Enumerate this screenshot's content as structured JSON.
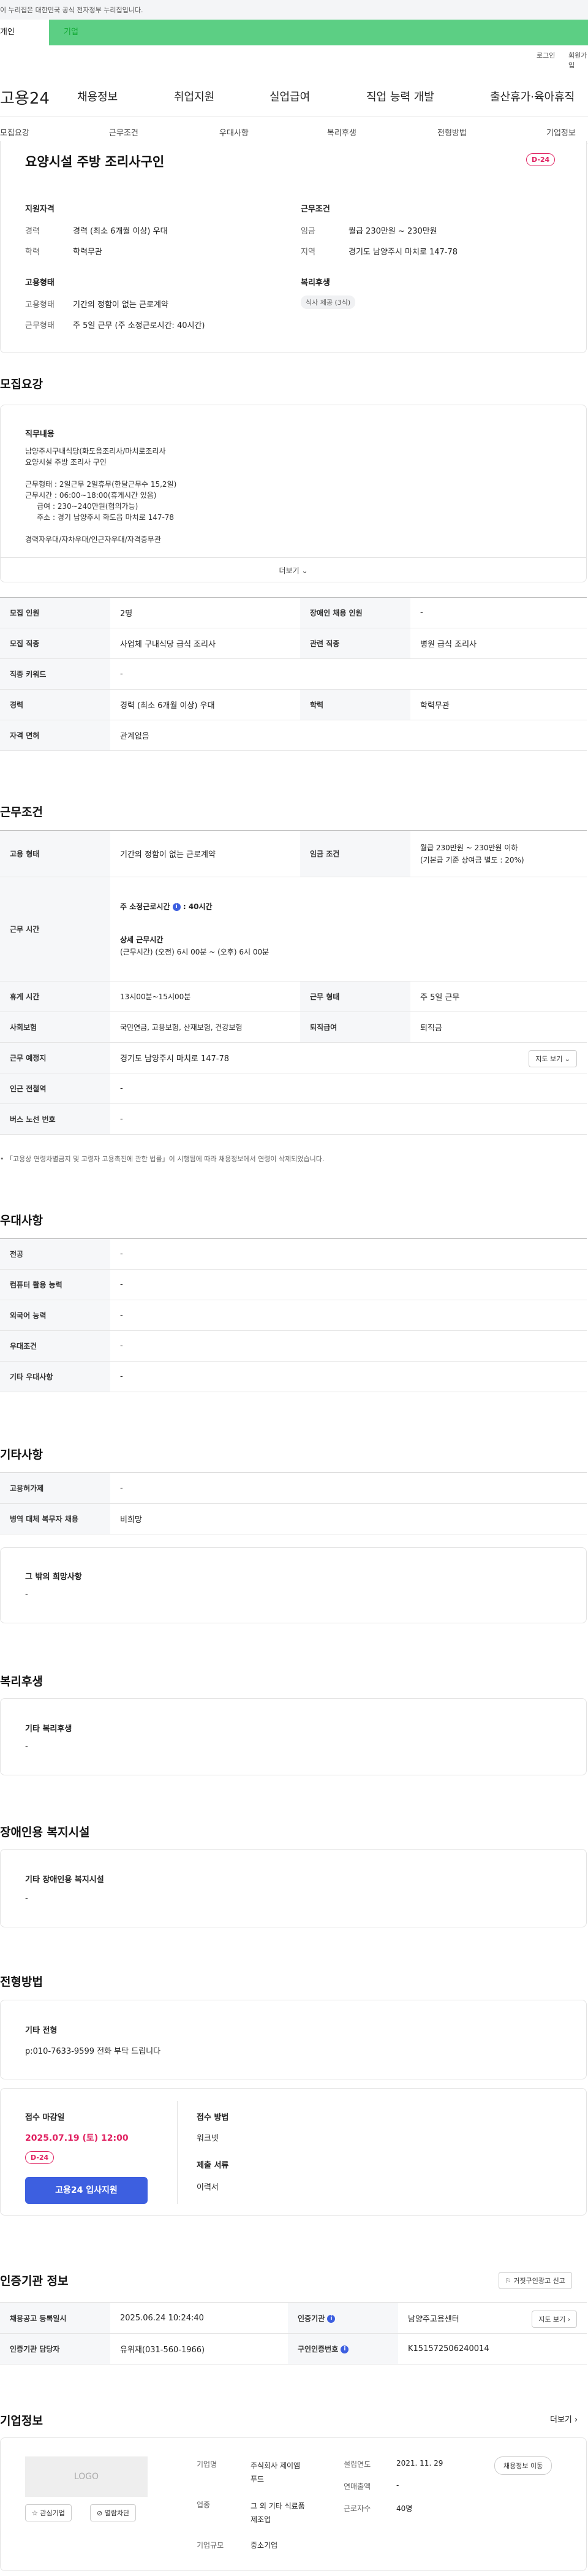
{
  "topbar": {
    "notice": "이 누리집은 대한민국 공식 전자정부 누리집입니다."
  },
  "greenbar": {
    "tab1": "개인",
    "tab2": "기업"
  },
  "util": {
    "login": "로그인",
    "join": "회원가입"
  },
  "gnb": {
    "logo": "고용24",
    "menu": [
      "채용정보",
      "취업지원",
      "실업급여",
      "직업 능력 개발",
      "출산휴가·육아휴직"
    ]
  },
  "subtabs": [
    "모집요강",
    "근무조건",
    "우대사항",
    "복리후생",
    "전형방법",
    "기업정보"
  ],
  "summary": {
    "title": "요양시설 주방 조리사구인",
    "dday": "D-24",
    "qual_title": "지원자격",
    "career_label": "경력",
    "career_val": "경력 (최소 6개월 이상) 우대",
    "edu_label": "학력",
    "edu_val": "학력무관",
    "cond_title": "근무조건",
    "wage_label": "임금",
    "wage_val": "월급 230만원 ~ 230만원",
    "area_label": "지역",
    "area_val": "경기도 남양주시 마치로 147-78",
    "emp_title": "고용형태",
    "emp_label": "고용형태",
    "emp_val": "기간의 정함이 없는 근로계약",
    "hours_label": "근무형태",
    "hours_val": "주 5일 근무 (주 소정근로시간: 40시간)",
    "welfare_title": "복리후생",
    "welfare_chip": "식사 제공 (3식)"
  },
  "recruit": {
    "title": "모집요강",
    "duty_title": "직무내용",
    "duty_lines": [
      "남양주시구내식당(화도읍조리사/마치로조리사",
      "요양시설 주방 조리사 구인",
      "",
      "근무형태 : 2일근무 2일휴무(한달근무수 15,2일)",
      "근무시간 : 06:00~18:00(휴게시간 있음)",
      "     급여 : 230~240만원(협의가능)",
      "     주소 : 경기 남양주시 화도읍 마치로 147-78",
      "",
      "경력자우대/자차우대/인근자우대/자격증무관"
    ],
    "more": "더보기",
    "rows": [
      {
        "h1": "모집 인원",
        "v1": "2명",
        "h2": "장애인 채용 인원",
        "v2": "-"
      },
      {
        "h1": "모집 직종",
        "v1": "사업체 구내식당 급식 조리사",
        "h2": "관련 직종",
        "v2": "병원 급식 조리사"
      },
      {
        "h1": "직종 키워드",
        "v1": "-"
      },
      {
        "h1": "경력",
        "v1": "경력 (최소 6개월 이상) 우대",
        "h2": "학력",
        "v2": "학력무관"
      },
      {
        "h1": "자격 면허",
        "v1": "관계없음"
      }
    ]
  },
  "work": {
    "title": "근무조건",
    "emp_h": "고용 형태",
    "emp_v": "기간의 정함이 없는 근로계약",
    "wage_h": "임금 조건",
    "wage_v1": "월급 230만원 ~ 230만원 이하",
    "wage_v2": "(기본급 기준 상여금 별도 : 20%)",
    "time_h": "근무 시간",
    "time_v1": "주 소정근로시간",
    "time_v1b": ": 40시간",
    "time_v2": "상세 근무시간",
    "time_v3": "(근무시간) (오전) 6시 00분 ~ (오후) 6시 00분",
    "rest_h": "휴게 시간",
    "rest_v": "13시00분~15시00분",
    "form_h": "근무 형태",
    "form_v": "주 5일 근무",
    "ins_h": "사회보험",
    "ins_v": "국민연금, 고용보험, 산재보험, 건강보험",
    "sev_h": "퇴직급여",
    "sev_v": "퇴직금",
    "place_h": "근무 예정지",
    "place_v": "경기도 남양주시 마치로 147-78",
    "map_btn": "지도 보기",
    "sub_h": "인근 전철역",
    "sub_v": "-",
    "bus_h": "버스 노선 번호",
    "bus_v": "-",
    "note": "「고용상 연령차별금지 및 고령자 고용촉진에 관한 법률」이 시행됨에 따라 채용정보에서 연령이 삭제되었습니다."
  },
  "pref": {
    "title": "우대사항",
    "rows": [
      {
        "h": "전공",
        "v": "-"
      },
      {
        "h": "컴퓨터 활용 능력",
        "v": "-"
      },
      {
        "h": "외국어 능력",
        "v": "-"
      },
      {
        "h": "우대조건",
        "v": "-"
      },
      {
        "h": "기타 우대사항",
        "v": "-"
      }
    ]
  },
  "etc": {
    "title": "기타사항",
    "rows": [
      {
        "h": "고용허가제",
        "v": "-"
      },
      {
        "h": "병역 대체 복무자 채용",
        "v": "비희망"
      }
    ],
    "box_title": "그 밖의 희망사항",
    "box_val": "-"
  },
  "welfare": {
    "title": "복리후생",
    "box_title": "기타 복리후생",
    "box_val": "-"
  },
  "disab": {
    "title": "장애인용 복지시설",
    "box_title": "기타 장애인용 복지시설",
    "box_val": "-"
  },
  "process": {
    "title": "전형방법",
    "box_title": "기타 전형",
    "box_val": "p:010-7633-9599 전화 부탁 드립니다",
    "deadline_label": "접수 마감일",
    "deadline_val": "2025.07.19 (토) 12:00",
    "dday": "D-24",
    "apply_btn": "고용24 입사지원",
    "method_label": "접수 방법",
    "method_val": "워크넷",
    "docs_label": "제출 서류",
    "docs_val": "이력서"
  },
  "cert": {
    "title": "인증기관 정보",
    "report_btn": "거짓구인광고 신고",
    "reg_h": "채용공고 등록일시",
    "reg_v": "2025.06.24 10:24:40",
    "org_h": "인증기관",
    "org_v": "남양주고용센터",
    "map_btn": "지도 보기",
    "mgr_h": "인증기관 담당자",
    "mgr_v": "유위재(031-560-1966)",
    "no_h": "구인인증번호",
    "no_v": "K151572506240014"
  },
  "company": {
    "title": "기업정보",
    "more": "더보기",
    "logo": "LOGO",
    "fav_btn": "관심기업",
    "block_btn": "열람차단",
    "name_l": "기업명",
    "name_v1": "주식회사 제이엠",
    "name_v2": "푸드",
    "ind_l": "업종",
    "ind_v1": "그 외 기타 식료품",
    "ind_v2": "제조업",
    "scale_l": "기업규모",
    "scale_v": "중소기업",
    "found_l": "설립연도",
    "found_v": "2021. 11. 29",
    "sales_l": "연매출액",
    "sales_v": "-",
    "staff_l": "근로자수",
    "staff_v": "40명",
    "jobs_btn": "채용정보 이동"
  },
  "colors": {
    "brand_green": "#5ccf84",
    "accent_blue": "#3d5fe0",
    "dday_red": "#e02060"
  }
}
